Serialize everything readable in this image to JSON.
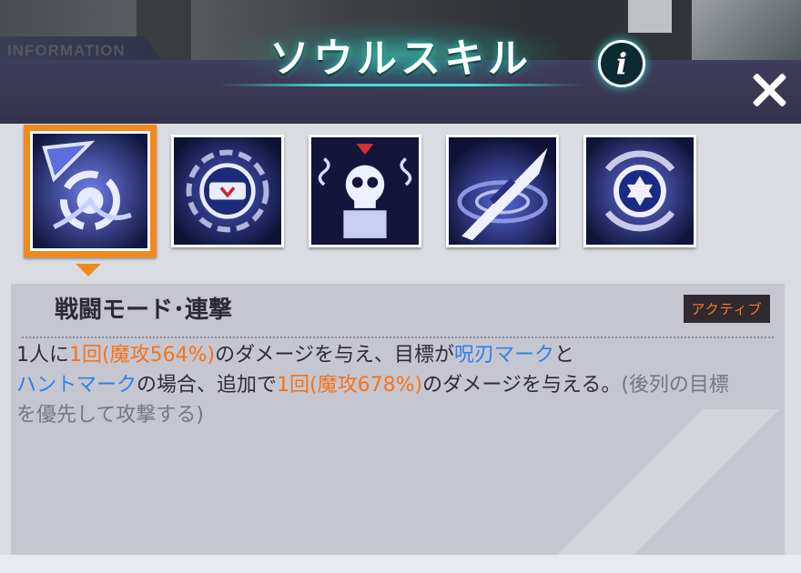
{
  "header": {
    "info_tab": "INFORMATION",
    "title": "ソウルスキル",
    "info_button": "i"
  },
  "skills": [
    {
      "icon": "vortex-claw-icon",
      "selected": true
    },
    {
      "icon": "shield-ring-icon",
      "selected": false
    },
    {
      "icon": "skull-mark-icon",
      "selected": false
    },
    {
      "icon": "blade-slash-icon",
      "selected": false
    },
    {
      "icon": "star-orb-icon",
      "selected": false
    }
  ],
  "description": {
    "name": "戦闘モード･連撃",
    "badge": "アクティブ",
    "parts": [
      {
        "t": "1人に",
        "c": ""
      },
      {
        "t": "1回",
        "c": "o"
      },
      {
        "t": "(魔攻564%)",
        "c": "o"
      },
      {
        "t": "のダメージを与え、目標が",
        "c": ""
      },
      {
        "t": "呪刃マーク",
        "c": "b"
      },
      {
        "t": "と",
        "c": ""
      },
      {
        "t": "ハントマーク",
        "c": "b"
      },
      {
        "t": "の場合、追加で",
        "c": ""
      },
      {
        "t": "1回",
        "c": "o"
      },
      {
        "t": "(魔攻678%)",
        "c": "o"
      },
      {
        "t": "のダメージを与える。",
        "c": ""
      },
      {
        "t": "(後列の目標を優先して攻撃する)",
        "c": "g"
      }
    ]
  },
  "colors": {
    "accent": "#f08a1c",
    "highlight_orange": "#f2741e",
    "highlight_blue": "#2f7fe8",
    "teal_glow": "#3fe0d0"
  }
}
